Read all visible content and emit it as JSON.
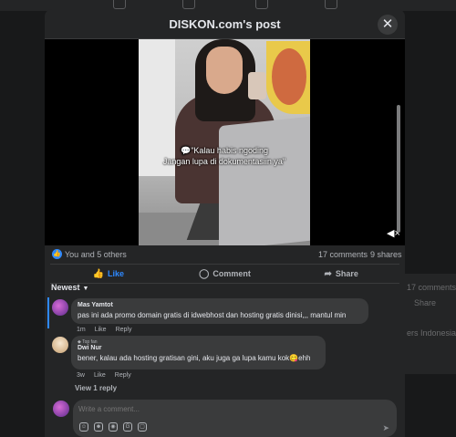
{
  "background": {
    "right_comments": "17 comments",
    "right_share": "Share",
    "right_group": "ers Indonesia"
  },
  "modal": {
    "title": "DISKON.com's post",
    "close_icon": "close-icon"
  },
  "video": {
    "caption_line1": "💬\"Kalau habis ngoding",
    "caption_line2": "Jangan lupa di dokumentasiin ya\"",
    "mute_icon": "speaker-muted-icon"
  },
  "stats": {
    "reactions": "You and 5 others",
    "comments": "17 comments",
    "shares": "9 shares"
  },
  "actions": {
    "like": "Like",
    "comment": "Comment",
    "share": "Share"
  },
  "sort": {
    "label": "Newest"
  },
  "comments": [
    {
      "author": "Mas Yamtot",
      "text": "pas ini ada promo domain gratis di idwebhost dan hosting gratis dinisi,,, mantul min",
      "time": "1m",
      "like": "Like",
      "reply": "Reply"
    },
    {
      "badge": "Top fan",
      "author": "Dwi Nur",
      "text": "bener, kalau ada hosting gratisan gini, aku juga ga lupa kamu kok😋ehh",
      "time": "3w",
      "like": "Like",
      "reply": "Reply"
    }
  ],
  "view_replies": "View 1 reply",
  "composer": {
    "placeholder": "Write a comment..."
  },
  "colors": {
    "accent": "#2e89ff",
    "surface": "#242526",
    "bubble": "#3a3b3c"
  }
}
